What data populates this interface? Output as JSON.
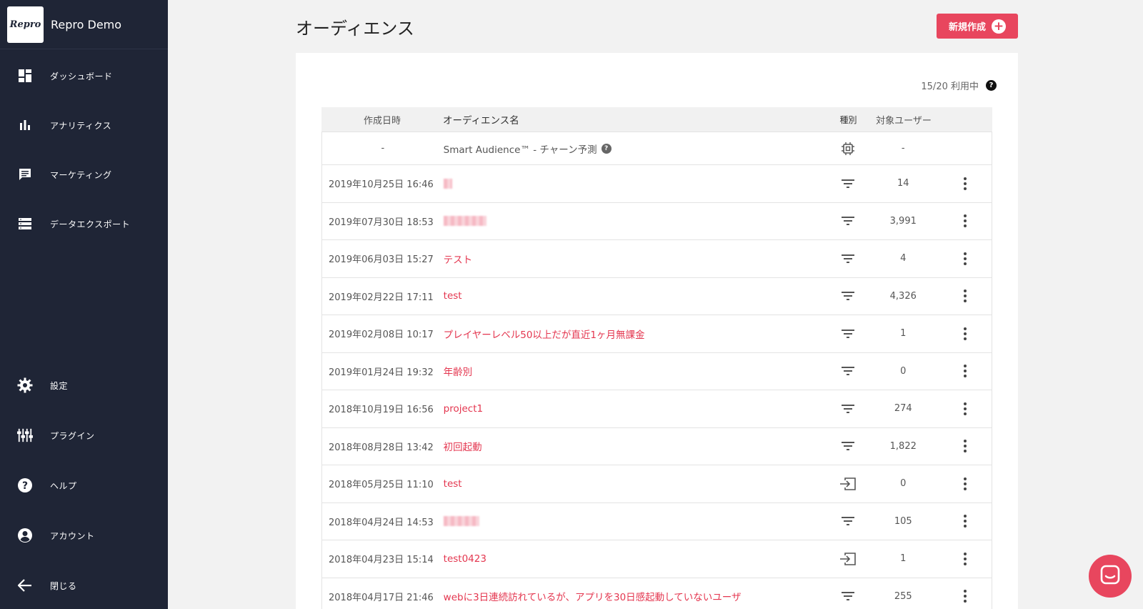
{
  "sidebar": {
    "logo_text": "Repro",
    "app_name": "Repro Demo",
    "top_items": [
      {
        "label": "ダッシュボード",
        "icon": "dashboard-icon"
      },
      {
        "label": "アナリティクス",
        "icon": "bar-chart-icon"
      },
      {
        "label": "マーケティング",
        "icon": "chat-icon"
      },
      {
        "label": "データエクスポート",
        "icon": "list-icon"
      }
    ],
    "bottom_items": [
      {
        "label": "設定",
        "icon": "gear-icon"
      },
      {
        "label": "プラグイン",
        "icon": "sliders-icon"
      },
      {
        "label": "ヘルプ",
        "icon": "help-icon"
      },
      {
        "label": "アカウント",
        "icon": "account-icon"
      },
      {
        "label": "閉じる",
        "icon": "arrow-left-icon"
      }
    ]
  },
  "header": {
    "title": "オーディエンス",
    "new_button": "新規作成"
  },
  "usage_text": "15/20 利用中",
  "table": {
    "columns": [
      "作成日時",
      "オーディエンス名",
      "種別",
      "対象ユーザー"
    ],
    "smart_row": {
      "date": "-",
      "name": "Smart Audience™ - チャーン予測",
      "users": "-"
    },
    "rows": [
      {
        "date": "2019年10月25日 16:46",
        "name": "",
        "users": "14"
      },
      {
        "date": "2019年07月30日 18:53",
        "name": "",
        "users": "3,991"
      },
      {
        "date": "2019年06月03日 15:27",
        "name": "テスト",
        "users": "4"
      },
      {
        "date": "2019年02月22日 17:11",
        "name": "test",
        "users": "4,326"
      },
      {
        "date": "2019年02月08日 10:17",
        "name": "プレイヤーレベル50以上だが直近1ヶ月無課金",
        "users": "1"
      },
      {
        "date": "2019年01月24日 19:32",
        "name": "年齢別",
        "users": "0"
      },
      {
        "date": "2018年10月19日 16:56",
        "name": "project1",
        "users": "274"
      },
      {
        "date": "2018年08月28日 13:42",
        "name": "初回起動",
        "users": "1,822"
      },
      {
        "date": "2018年05月25日 11:10",
        "name": "test",
        "users": "0"
      },
      {
        "date": "2018年04月24日 14:53",
        "name": "",
        "users": "105"
      },
      {
        "date": "2018年04月23日 15:14",
        "name": "test0423",
        "users": "1"
      },
      {
        "date": "2018年04月17日 21:46",
        "name": "webに3日連続訪れているが、アプリを30日感起動していないユーザ",
        "users": "255"
      }
    ]
  },
  "colors": {
    "accent": "#e8465e",
    "sidebar": "#1f2536",
    "link": "#e4364f"
  }
}
